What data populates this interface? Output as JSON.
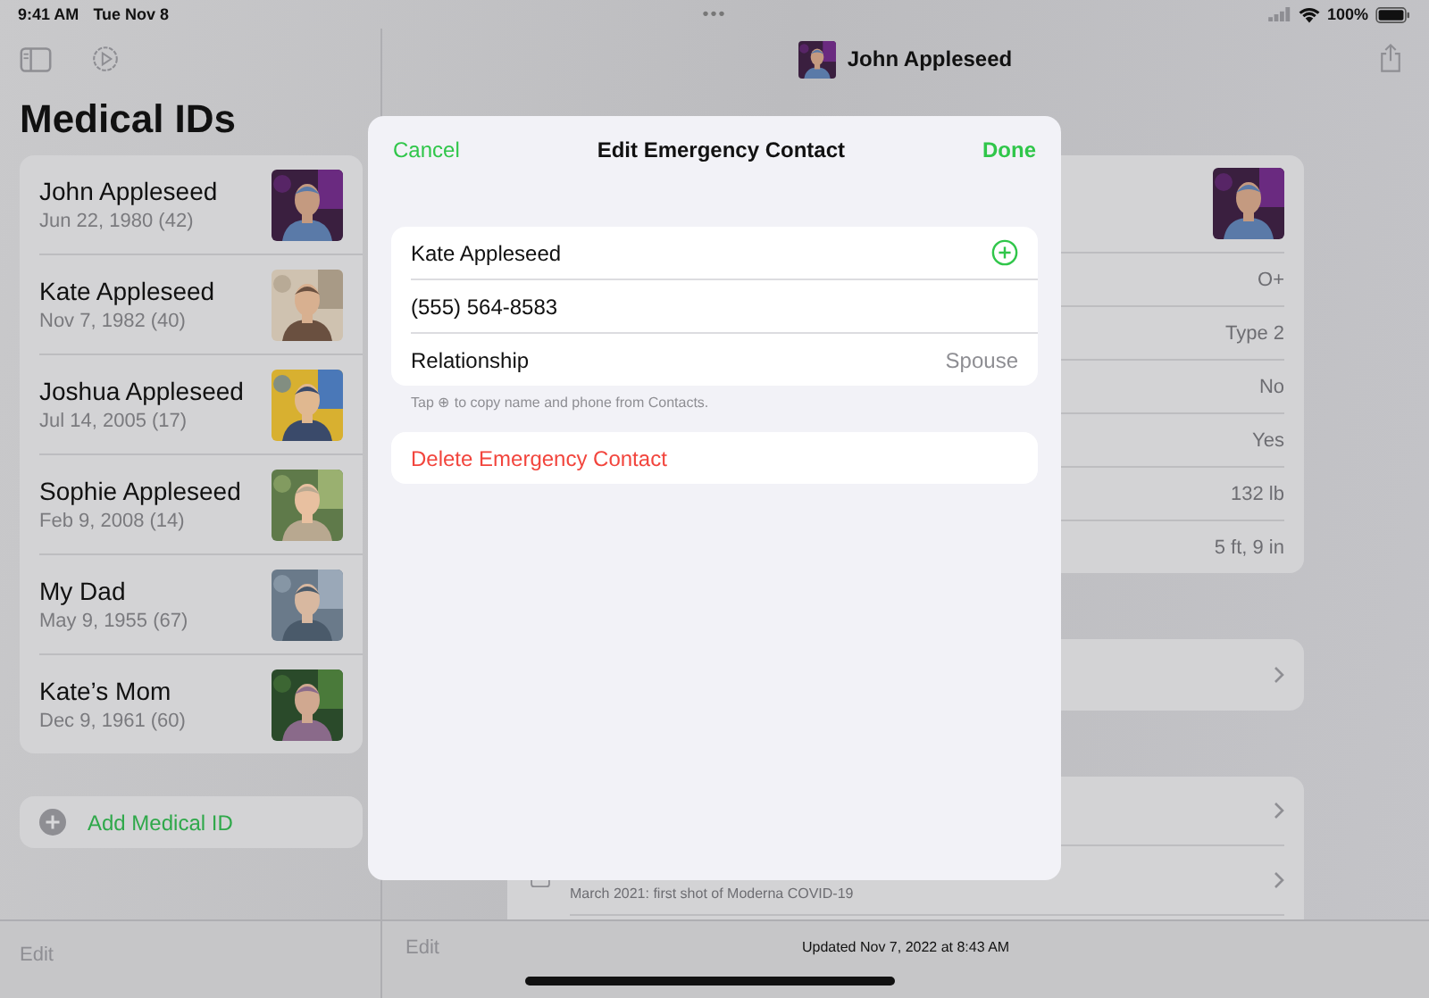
{
  "status_bar": {
    "time": "9:41 AM",
    "date": "Tue Nov 8",
    "dots": "•••",
    "battery": "100%"
  },
  "sidebar": {
    "title": "Medical IDs",
    "people": [
      {
        "name": "John Appleseed",
        "birth": "Jun 22, 1980 (42)"
      },
      {
        "name": "Kate Appleseed",
        "birth": "Nov 7, 1982 (40)"
      },
      {
        "name": "Joshua Appleseed",
        "birth": "Jul 14, 2005 (17)"
      },
      {
        "name": "Sophie Appleseed",
        "birth": "Feb 9, 2008 (14)"
      },
      {
        "name": "My Dad",
        "birth": "May 9, 1955 (67)"
      },
      {
        "name": "Kate’s Mom",
        "birth": "Dec 9, 1961 (60)"
      }
    ],
    "add_label": "Add Medical ID",
    "edit": "Edit"
  },
  "detail": {
    "title": "John Appleseed",
    "values": [
      "O+",
      "Type 2",
      "No",
      "Yes",
      "132 lb",
      "5 ft, 9 in"
    ],
    "vaccine_note": "March 2021: first shot of Moderna COVID-19",
    "edit": "Edit",
    "updated": "Updated Nov 7, 2022 at 8:43 AM"
  },
  "modal": {
    "cancel": "Cancel",
    "title": "Edit Emergency Contact",
    "done": "Done",
    "name": "Kate Appleseed",
    "phone": "(555) 564-8583",
    "relationship_label": "Relationship",
    "relationship_value": "Spouse",
    "hint": "Tap ⊕ to copy name and phone from Contacts.",
    "delete": "Delete Emergency Contact"
  }
}
